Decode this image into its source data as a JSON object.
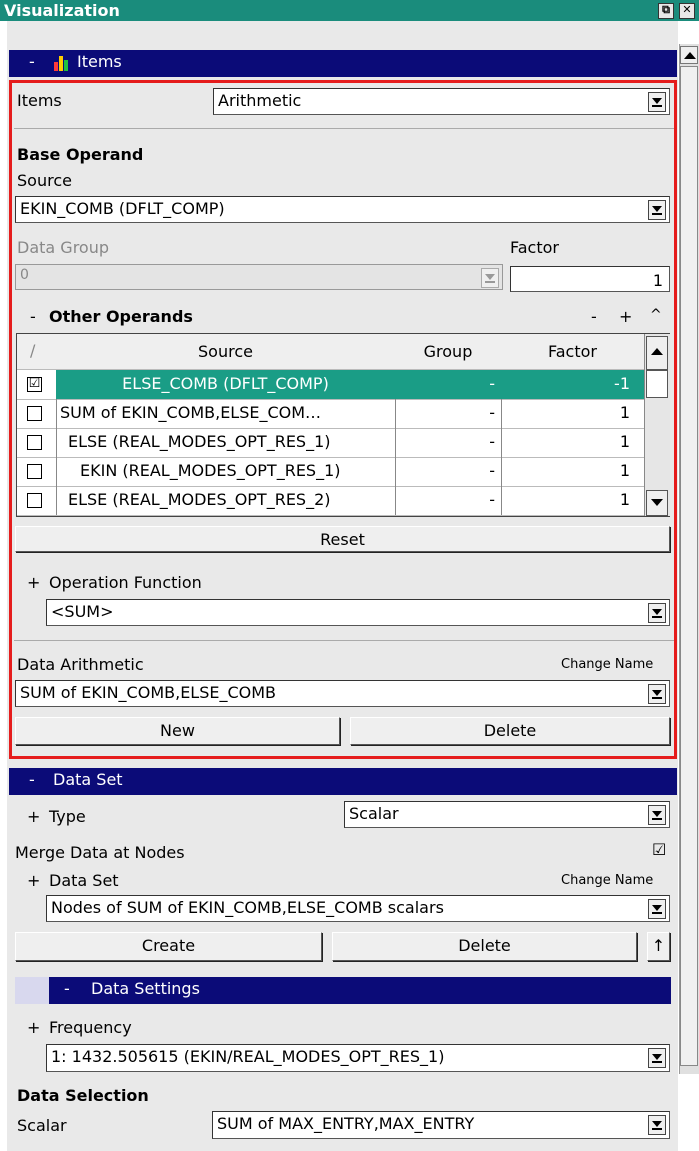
{
  "window": {
    "title": "Visualization",
    "float_glyph": "⧉",
    "close_glyph": "✕"
  },
  "items_section": {
    "collapse": "-",
    "title": "Items",
    "items_label": "Items",
    "items_value": "Arithmetic",
    "base_operand_title": "Base Operand",
    "source_label": "Source",
    "source_value": "EKIN_COMB (DFLT_COMP)",
    "data_group_label": "Data Group",
    "data_group_value": "0",
    "factor_label": "Factor",
    "factor_value": "1"
  },
  "other_operands": {
    "collapse": "-",
    "title": "Other Operands",
    "controls": [
      "-",
      "+",
      "^"
    ],
    "columns": {
      "sort": "/",
      "source": "Source",
      "group": "Group",
      "factor": "Factor"
    },
    "rows": [
      {
        "checked": "☑",
        "source": "ELSE_COMB (DFLT_COMP)",
        "group": "-",
        "factor": "-1",
        "selected": true
      },
      {
        "checked": "",
        "source": "SUM of EKIN_COMB,ELSE_COM…",
        "group": "-",
        "factor": "1"
      },
      {
        "checked": "",
        "source": "ELSE (REAL_MODES_OPT_RES_1)",
        "group": "-",
        "factor": "1"
      },
      {
        "checked": "",
        "source": "EKIN (REAL_MODES_OPT_RES_1)",
        "group": "-",
        "factor": "1"
      },
      {
        "checked": "",
        "source": "ELSE (REAL_MODES_OPT_RES_2)",
        "group": "-",
        "factor": "1"
      }
    ],
    "reset_label": "Reset"
  },
  "operation_function": {
    "expand": "+",
    "label": "Operation Function",
    "value": "<SUM>"
  },
  "data_arithmetic": {
    "label": "Data Arithmetic",
    "change_name": "Change Name",
    "value": "SUM of EKIN_COMB,ELSE_COMB",
    "new_label": "New",
    "delete_label": "Delete"
  },
  "data_set_section": {
    "collapse": "-",
    "title": "Data Set",
    "type_expand": "+",
    "type_label": "Type",
    "type_value": "Scalar",
    "merge_label": "Merge Data at Nodes",
    "merge_checked": "☑",
    "dataset_expand": "+",
    "dataset_label": "Data Set",
    "change_name": "Change Name",
    "dataset_value": "Nodes of SUM of EKIN_COMB,ELSE_COMB scalars",
    "create_label": "Create",
    "delete_label": "Delete",
    "up_label": "↑"
  },
  "data_settings": {
    "collapse": "-",
    "title": "Data Settings",
    "freq_expand": "+",
    "freq_label": "Frequency",
    "freq_value": "1: 1432.505615 (EKIN/REAL_MODES_OPT_RES_1)",
    "selection_title": "Data Selection",
    "scalar_label": "Scalar",
    "scalar_value": "SUM of MAX_ENTRY,MAX_ENTRY"
  }
}
